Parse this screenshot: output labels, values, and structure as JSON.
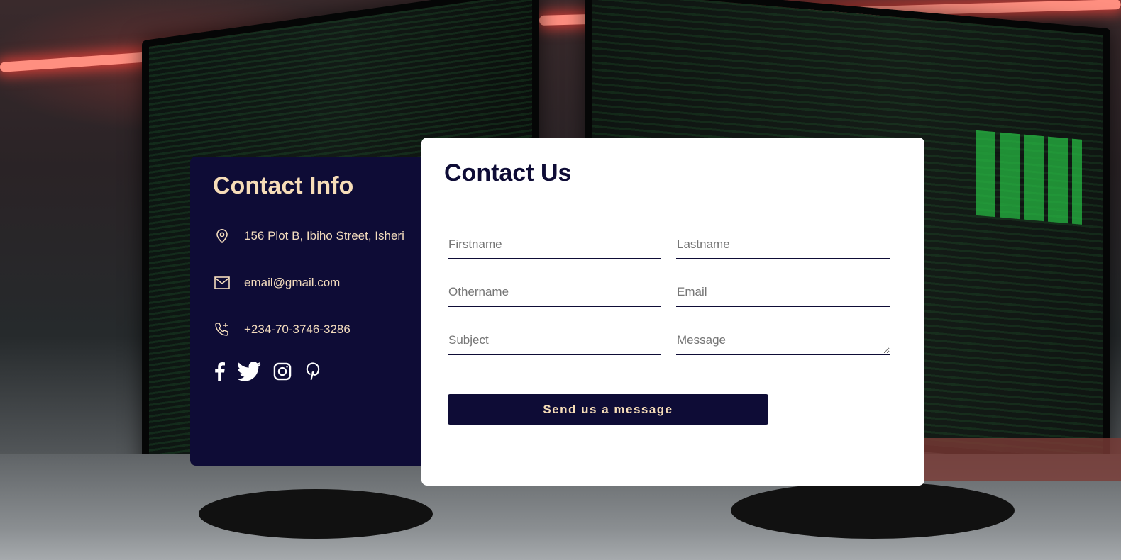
{
  "contact_info": {
    "title": "Contact Info",
    "address": "156 Plot B, Ibiho Street, Isheri",
    "email": "email@gmail.com",
    "phone": "+234-70-3746-3286",
    "icons": {
      "address": "location-pin-icon",
      "email": "envelope-icon",
      "phone": "phone-icon"
    },
    "social": [
      "facebook-icon",
      "twitter-icon",
      "instagram-icon",
      "pinterest-icon"
    ]
  },
  "form": {
    "title": "Contact Us",
    "firstname_placeholder": "Firstname",
    "lastname_placeholder": "Lastname",
    "othername_placeholder": "Othername",
    "email_placeholder": "Email",
    "subject_placeholder": "Subject",
    "message_placeholder": "Message",
    "submit_label": "Send us a message"
  },
  "colors": {
    "navy": "#0e0c36",
    "cream": "#f6ddb8",
    "card_bg": "#ffffff"
  }
}
